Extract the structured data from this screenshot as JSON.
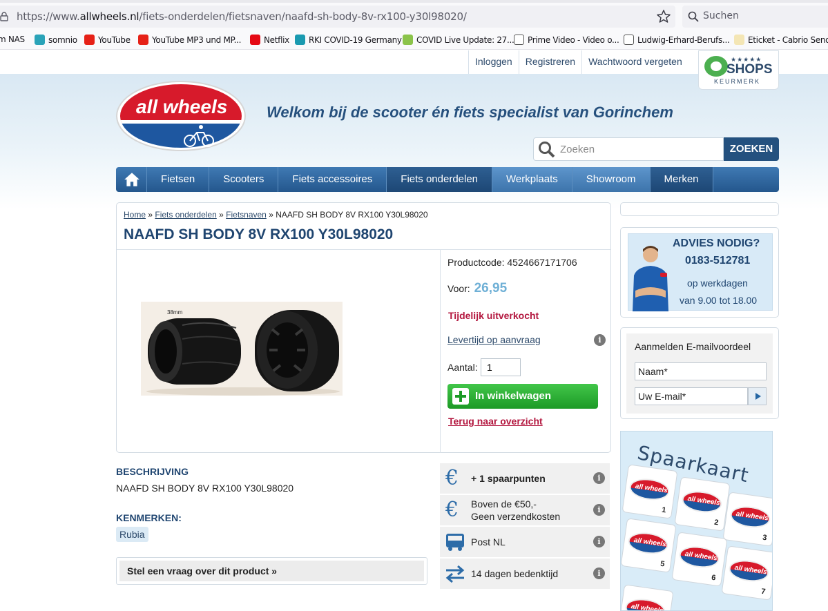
{
  "browser": {
    "url_prefix": "https://www.",
    "url_domain": "allwheels.nl",
    "url_path": "/fiets-onderdelen/fietsnaven/naafd-sh-body-8v-rx100-y30l98020/",
    "search_placeholder": "Suchen",
    "bookmarks": [
      {
        "label": "m NAS",
        "color": "#1f1f1f"
      },
      {
        "label": "somnio",
        "color": "#2aa3b8"
      },
      {
        "label": "YouTube",
        "color": "#e62117"
      },
      {
        "label": "YouTube MP3 und MP...",
        "color": "#e62117"
      },
      {
        "label": "Netflix",
        "color": "#e50914"
      },
      {
        "label": "RKI COVID-19 Germany",
        "color": "#1a9ab0"
      },
      {
        "label": "COVID Live Update: 27...",
        "color": "#8bc34a"
      },
      {
        "label": "Prime Video - Video o...",
        "color": "#ffffff"
      },
      {
        "label": "Ludwig-Erhard-Berufs...",
        "color": "#ffffff"
      },
      {
        "label": "Eticket - Cabrio Sender",
        "color": "#f4e6b5"
      }
    ]
  },
  "header": {
    "links": [
      "Inloggen",
      "Registreren",
      "Wachtwoord vergeten"
    ],
    "keurmerk": {
      "stars": "★★★★★",
      "shops": "SHOPS",
      "label": "KEURMERK"
    },
    "logo_text": "all wheels",
    "welcome": "Welkom bij de scooter én fiets specialist van Gorinchem",
    "search_placeholder": "Zoeken",
    "search_button": "ZOEKEN"
  },
  "nav": {
    "items": [
      "Fietsen",
      "Scooters",
      "Fiets accessoires",
      "Fiets onderdelen",
      "Werkplaats",
      "Showroom",
      "Merken"
    ]
  },
  "product": {
    "breadcrumb": {
      "home": "Home",
      "sep": "»",
      "cat": "Fiets onderdelen",
      "sub": "Fietsnaven",
      "current": "NAAFD SH BODY 8V RX100 Y30L98020"
    },
    "title": "NAAFD SH BODY 8V RX100 Y30L98020",
    "image_label": "38mm",
    "productcode_label": "Productcode:",
    "productcode": "4524667171706",
    "voor_label": "Voor:",
    "price": "26,95",
    "status": "Tijdelijk uitverkocht",
    "levertijd": "Levertijd op aanvraag",
    "aantal_label": "Aantal:",
    "aantal_value": "1",
    "cart_button": "In winkelwagen",
    "back_link": "Terug naar overzicht"
  },
  "description": {
    "heading": "BESCHRIJVING",
    "text": "NAAFD SH BODY 8V RX100 Y30L98020",
    "kenmerken_heading": "KENMERKEN:",
    "kenmerken_tag": "Rubia",
    "vraag": "Stel een vraag over dit product »"
  },
  "benefits": [
    {
      "icon": "euro-icon",
      "text": "+ 1 spaarpunten",
      "bold": true
    },
    {
      "icon": "euro-icon",
      "text": "Boven de €50,-",
      "text2": "Geen verzendkosten"
    },
    {
      "icon": "truck-icon",
      "text": "Post NL"
    },
    {
      "icon": "return-arrows-icon",
      "text": "14 dagen bedenktijd"
    }
  ],
  "sidebar": {
    "advies_heading": "ADVIES NODIG?",
    "phone": "0183-512781",
    "hours1": "op werkdagen",
    "hours2": "van 9.00 tot 18.00",
    "mail_heading": "Aanmelden E-mailvoordeel",
    "name_placeholder": "Naam*",
    "email_placeholder": "Uw E-mail*",
    "spaarkaart_title": "Spaarkaart",
    "card_logo": "all wheels",
    "card_numbers": [
      "1",
      "2",
      "3",
      "5",
      "6",
      "7",
      ""
    ]
  }
}
